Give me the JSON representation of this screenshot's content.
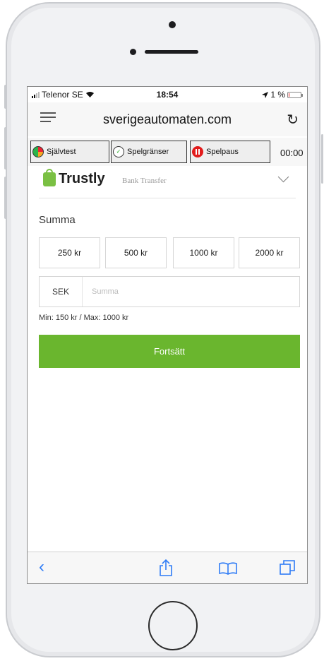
{
  "status_bar": {
    "carrier": "Telenor SE",
    "time": "18:54",
    "battery": "1 %"
  },
  "browser": {
    "host": "sverigeautomaten.com"
  },
  "responsible_gaming": {
    "self_test_label": "Självtest",
    "limits_label": "Spelgränser",
    "pause_label": "Spelpaus",
    "session_time": "00:00"
  },
  "payment": {
    "brand": "Trustly",
    "method": "Bank Transfer"
  },
  "amount": {
    "label": "Summa",
    "presets": [
      "250 kr",
      "500 kr",
      "1000 kr",
      "2000 kr"
    ],
    "currency": "SEK",
    "placeholder": "Summa",
    "limits_text": "Min: 150 kr / Max: 1000 kr"
  },
  "continue_label": "Fortsätt",
  "icons": [
    "menu-icon",
    "reload-icon",
    "gauge-icon",
    "limits-icon",
    "pause-icon",
    "chevron-down-icon",
    "back-icon",
    "share-icon",
    "bookmarks-icon",
    "tabs-icon"
  ],
  "colors": {
    "accent_green": "#6ab62e",
    "ios_blue": "#2f7cf6",
    "pause_red": "#e21b1b"
  }
}
